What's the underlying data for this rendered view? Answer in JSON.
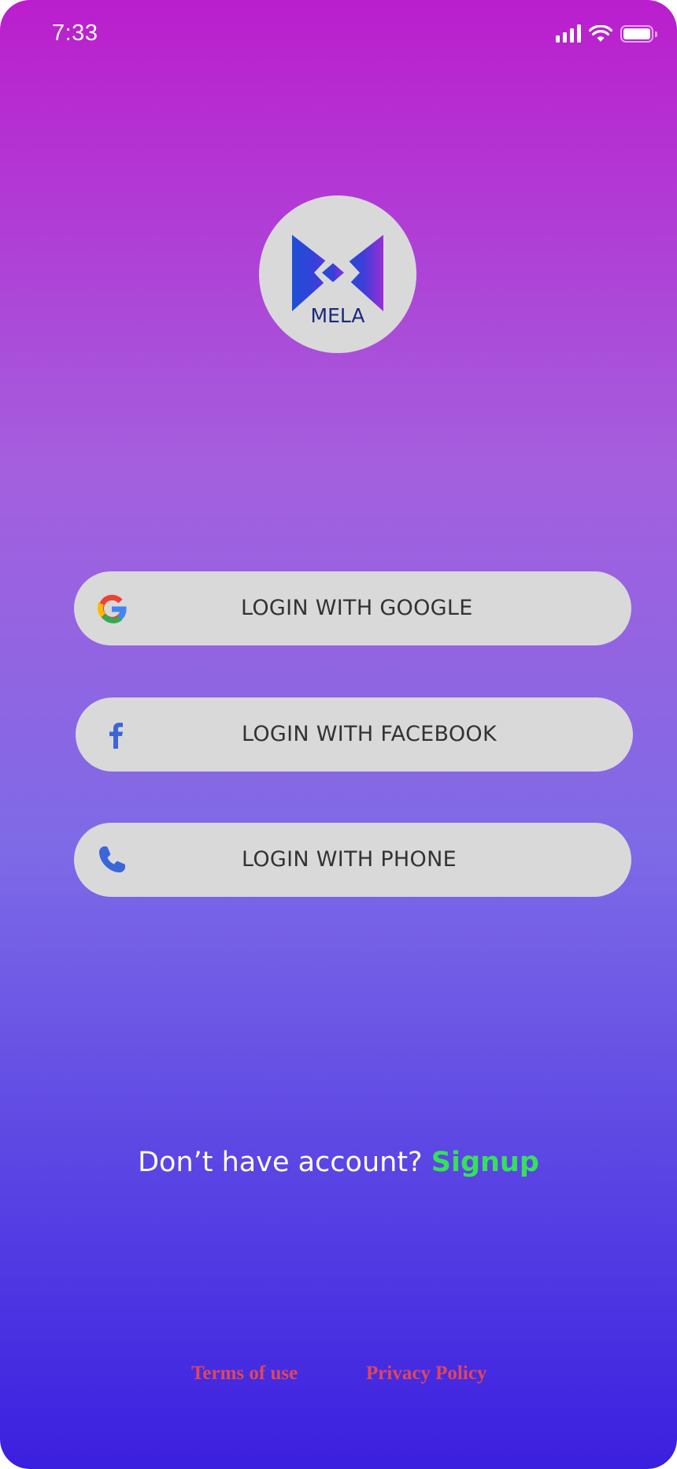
{
  "status_bar": {
    "time": "7:33"
  },
  "logo": {
    "text": "MELA"
  },
  "buttons": {
    "google": {
      "label": "LOGIN WITH GOOGLE",
      "icon": "google-icon"
    },
    "facebook": {
      "label": "LOGIN WITH FACEBOOK",
      "icon": "facebook-icon"
    },
    "phone": {
      "label": "LOGIN WITH PHONE",
      "icon": "phone-icon"
    }
  },
  "signup": {
    "prompt": "Don’t have account? ",
    "link": "Signup"
  },
  "footer": {
    "terms": "Terms of use",
    "privacy": "Privacy Policy"
  },
  "colors": {
    "gradient_top": "#bb1ecd",
    "gradient_bottom": "#3b1fdf",
    "button_bg": "#d9d9d9",
    "signup_link": "#35e05a",
    "footer_link": "#e0465a"
  }
}
